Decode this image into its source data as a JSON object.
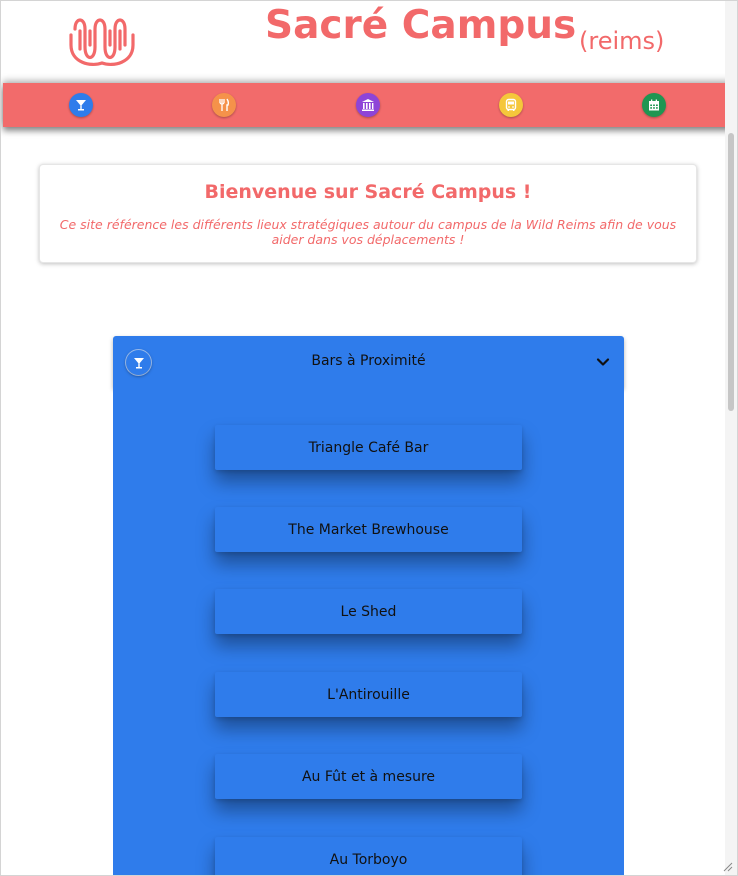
{
  "header": {
    "title": "Sacré Campus",
    "subtitle": "(reims)",
    "logo": "wild-code-school-wave-logo"
  },
  "nav": {
    "items": [
      {
        "name": "bars",
        "icon": "cocktail-icon",
        "color": "#2f7ceb"
      },
      {
        "name": "restaurants",
        "icon": "fork-knife-icon",
        "color": "#f5924a"
      },
      {
        "name": "culture",
        "icon": "museum-icon",
        "color": "#8e44d8"
      },
      {
        "name": "transport",
        "icon": "bus-icon",
        "color": "#f5c73b"
      },
      {
        "name": "events",
        "icon": "calendar-icon",
        "color": "#1f9652"
      }
    ],
    "bar_color": "#f26b6b"
  },
  "welcome": {
    "heading": "Bienvenue sur Sacré Campus !",
    "text": "Ce site référence les différents lieux stratégiques autour du campus de la Wild Reims afin de vous aider dans vos déplacements !"
  },
  "accordion": {
    "title": "Bars à Proximité",
    "icon": "cocktail-icon",
    "expanded": true,
    "color": "#2f7ceb",
    "items": [
      "Triangle Café Bar",
      "The Market Brewhouse",
      "Le Shed",
      "L'Antirouille",
      "Au Fût et à mesure",
      "Au Torboyo"
    ]
  },
  "colors": {
    "accent": "#f2696a",
    "panel": "#2f7ceb"
  }
}
